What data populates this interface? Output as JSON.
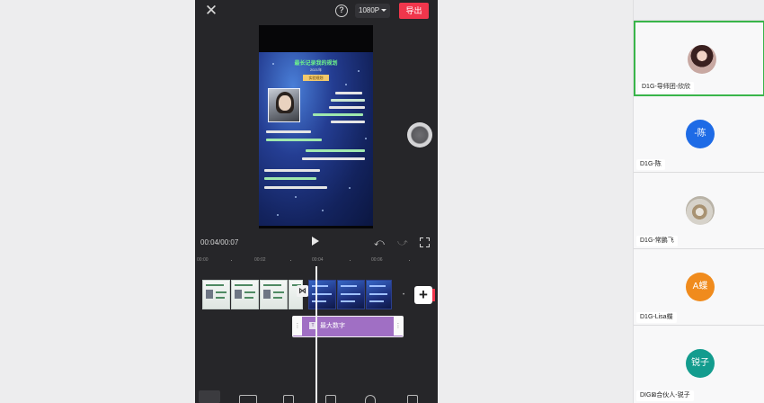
{
  "editor": {
    "close_icon": "close-icon",
    "help_icon": "question-circle-icon",
    "resolution": "1080P",
    "export_label": "导出",
    "accent_color": "#f0364c",
    "poster": {
      "title": "最长记录我的规划",
      "subtitle": "2021年",
      "badge": "实验规划"
    },
    "timecode": "00:04/00:07",
    "ruler_ticks": [
      "00:00",
      "00:02",
      "00:04",
      "00:06"
    ],
    "text_clip_label": "最大数字",
    "text_clip_color": "#a06fc4",
    "add_clip_label": "+",
    "transition_label": "⋈"
  },
  "participants": [
    {
      "name": "D1G-导师团-欣欣",
      "avatar": "photo",
      "active": true
    },
    {
      "name": "D1G-陈",
      "avatar_text": "-陈",
      "avatar_color": "#1e6be6"
    },
    {
      "name": "D1G-常鹏飞",
      "avatar": "photo"
    },
    {
      "name": "D1G-Lisa蝶",
      "avatar_text": "A蝶",
      "avatar_color": "#f08b1d"
    },
    {
      "name": "DIG⊠合伙人-锐子",
      "avatar_text": "锐子",
      "avatar_color": "#139c8e"
    }
  ]
}
